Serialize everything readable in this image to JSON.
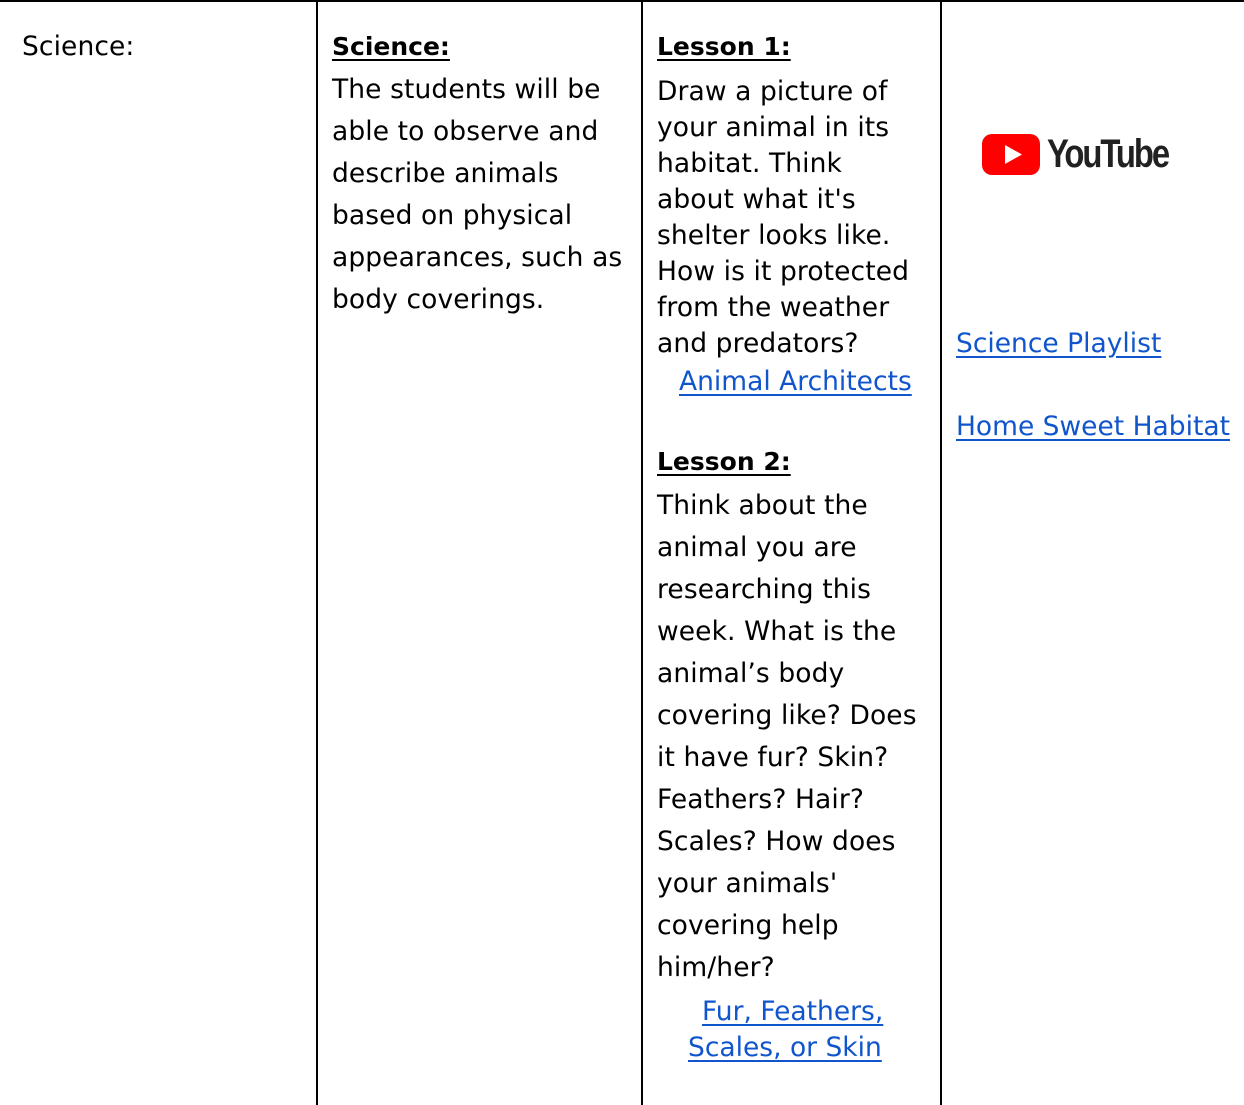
{
  "col_subject": {
    "label": "Science:"
  },
  "col_objective": {
    "heading": "Science:",
    "lines": [
      "The students will be",
      "able to observe and",
      "describe animals",
      "based on physical",
      "appearances, such as",
      "body coverings."
    ]
  },
  "col_lessons": {
    "lesson1": {
      "heading": "Lesson 1:",
      "lines": [
        "Draw a picture of",
        "your animal in its",
        "habitat.  Think",
        "about what it's",
        "shelter looks like.",
        "How is it protected",
        "from the weather",
        "and predators?"
      ],
      "link": "Animal Architects"
    },
    "lesson2": {
      "heading": "Lesson 2:",
      "lines": [
        "Think about the",
        "animal you are",
        "researching this",
        "week. What is the",
        "animal’s body",
        "covering like? Does",
        "it have fur? Skin?",
        "Feathers? Hair?",
        "Scales? How does",
        "your animals'",
        "covering help",
        "him/her?"
      ],
      "link_lines": [
        "Fur, Feathers,",
        "Scales, or Skin"
      ]
    }
  },
  "col_resources": {
    "logo_text": "YouTube",
    "links": [
      "Science Playlist",
      "Home Sweet Habitat"
    ]
  },
  "colors": {
    "link": "#1155cc",
    "youtube_red": "#ff0000"
  }
}
